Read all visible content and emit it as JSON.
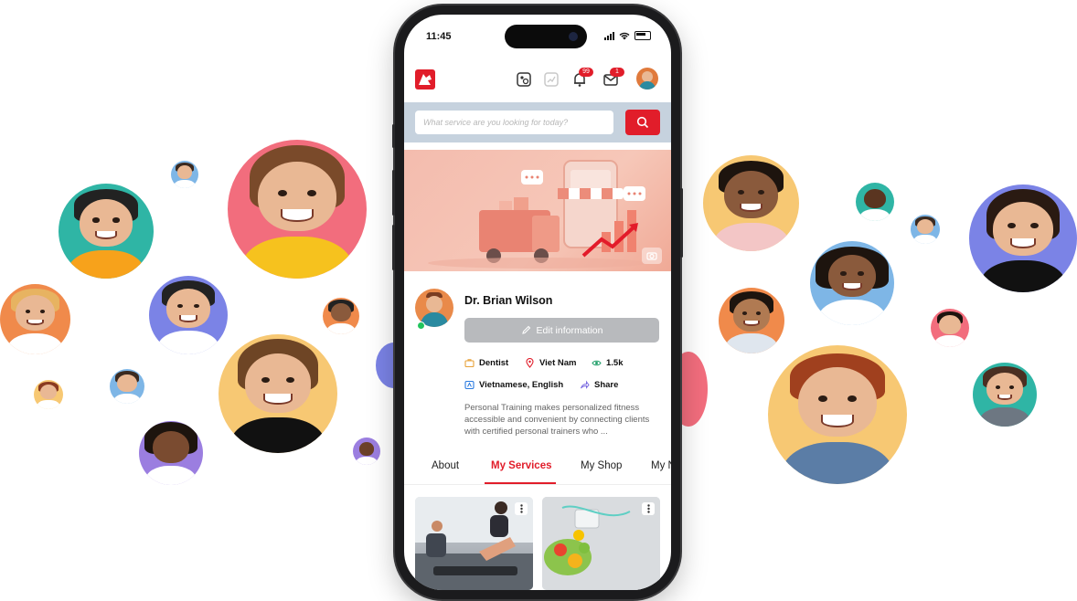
{
  "status_bar": {
    "time": "11:45"
  },
  "header": {
    "notification_badge": "99",
    "message_badge": "1"
  },
  "search": {
    "placeholder": "What service are you looking for today?"
  },
  "profile": {
    "name": "Dr. Brian Wilson",
    "edit_label": "Edit information",
    "profession": "Dentist",
    "location": "Viet Nam",
    "views": "1.5k",
    "languages": "Vietnamese, English",
    "share_label": "Share",
    "bio": "Personal Training makes personalized fitness accessible and convenient by connecting clients with certified personal trainers who ..."
  },
  "tabs": [
    {
      "label": "About"
    },
    {
      "label": "My Services"
    },
    {
      "label": "My Shop"
    },
    {
      "label": "My N"
    }
  ],
  "active_tab": "My Services",
  "colors": {
    "accent": "#e11d2a",
    "search_band": "#c6d2de",
    "edit_button": "#b8babd"
  },
  "icons": [
    "logo-icon",
    "scan-icon",
    "chart-icon",
    "bell-icon",
    "mail-icon",
    "search-icon",
    "camera-icon",
    "pencil-icon",
    "briefcase-icon",
    "pin-icon",
    "eye-icon",
    "language-icon",
    "share-icon",
    "more-icon"
  ]
}
